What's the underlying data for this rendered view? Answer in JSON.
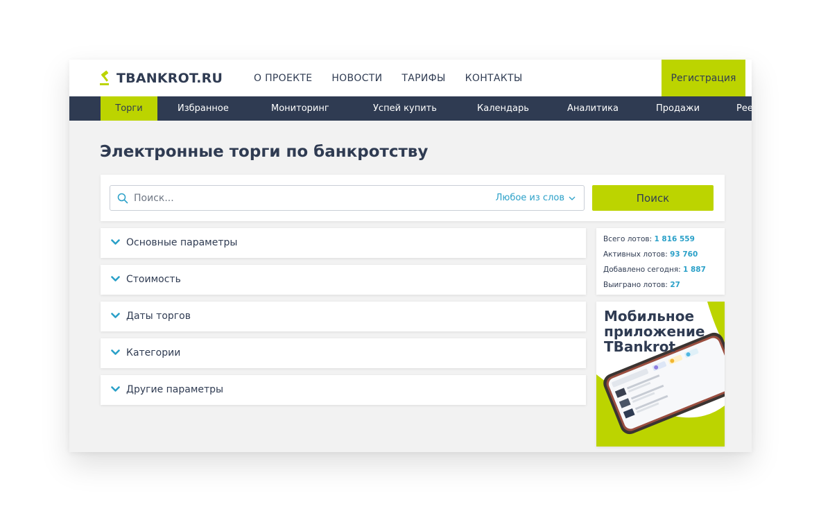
{
  "header": {
    "logo_text": "TBANKROT.RU",
    "nav": [
      "О ПРОЕКТЕ",
      "НОВОСТИ",
      "ТАРИФЫ",
      "КОНТАКТЫ"
    ],
    "register_label": "Регистрация"
  },
  "subnav": {
    "items": [
      "Торги",
      "Избранное",
      "Мониторинг",
      "Успей купить",
      "Календарь",
      "Аналитика",
      "Продажи",
      "Рее"
    ],
    "active_index": 0
  },
  "page_title": "Электронные торги по банкротству",
  "search": {
    "placeholder": "Поиск...",
    "mode_label": "Любое из слов",
    "button_label": "Поиск"
  },
  "filters": [
    "Основные параметры",
    "Стоимость",
    "Даты торгов",
    "Категории",
    "Другие параметры"
  ],
  "stats": [
    {
      "label": "Всего лотов:",
      "value": "1 816 559"
    },
    {
      "label": "Активных лотов:",
      "value": "93 760"
    },
    {
      "label": "Добавлено сегодня:",
      "value": "1 887"
    },
    {
      "label": "Выиграно лотов:",
      "value": "27"
    }
  ],
  "promo": {
    "title": "Мобильное приложение TBankrot"
  },
  "colors": {
    "accent": "#bcd400",
    "dark": "#2f3b52",
    "link": "#2aa0c8",
    "background": "#f2f2f2"
  }
}
